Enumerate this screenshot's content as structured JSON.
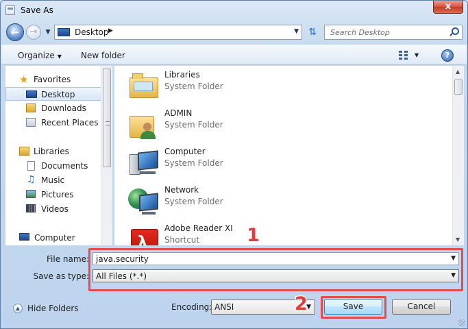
{
  "window": {
    "title": "Save As",
    "close_label": "x"
  },
  "nav": {
    "address_crumb": "Desktop",
    "address_arrow": "▶",
    "search_placeholder": "Search Desktop"
  },
  "toolbar": {
    "organize_label": "Organize",
    "new_folder_label": "New folder",
    "help_label": "?"
  },
  "sidebar": {
    "items": [
      {
        "label": "Favorites",
        "icon": "star-icon"
      },
      {
        "label": "Desktop",
        "icon": "desktop-icon",
        "selected": true
      },
      {
        "label": "Downloads",
        "icon": "downloads-icon"
      },
      {
        "label": "Recent Places",
        "icon": "recent-places-icon"
      },
      {
        "label": "Libraries",
        "icon": "libraries-icon"
      },
      {
        "label": "Documents",
        "icon": "documents-icon"
      },
      {
        "label": "Music",
        "icon": "music-icon"
      },
      {
        "label": "Pictures",
        "icon": "pictures-icon"
      },
      {
        "label": "Videos",
        "icon": "videos-icon"
      },
      {
        "label": "Computer",
        "icon": "computer-icon"
      }
    ]
  },
  "files": [
    {
      "name": "Libraries",
      "type": "System Folder",
      "icon": "libraries-folder-icon"
    },
    {
      "name": "ADMIN",
      "type": "System Folder",
      "icon": "user-folder-icon"
    },
    {
      "name": "Computer",
      "type": "System Folder",
      "icon": "computer-icon"
    },
    {
      "name": "Network",
      "type": "System Folder",
      "icon": "network-icon"
    },
    {
      "name": "Adobe Reader XI",
      "type": "Shortcut",
      "icon": "adobe-reader-icon"
    }
  ],
  "form": {
    "filename_label": "File name:",
    "filename_value": "java.security",
    "savetype_label": "Save as type:",
    "savetype_value": "All Files  (*.*)"
  },
  "footer": {
    "hide_folders_label": "Hide Folders",
    "encoding_label": "Encoding:",
    "encoding_value": "ANSI",
    "save_label": "Save",
    "cancel_label": "Cancel"
  },
  "annotations": {
    "marker_1": "1",
    "marker_2": "2"
  },
  "colors": {
    "highlight": "#e64a4a",
    "accent": "#3c7fb1"
  }
}
